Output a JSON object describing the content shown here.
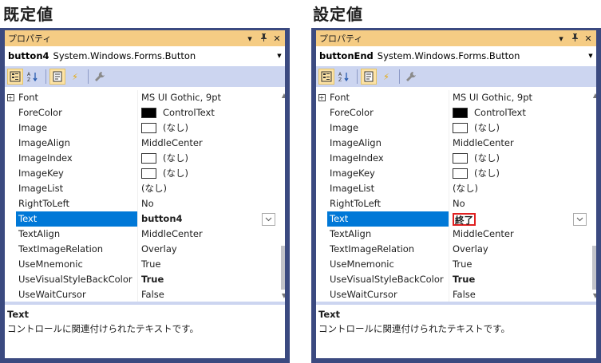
{
  "left": {
    "heading": "既定値",
    "title": "プロパティ",
    "object_name": "button4",
    "object_type": "System.Windows.Forms.Button",
    "properties": [
      {
        "name": "Font",
        "value": "MS UI Gothic, 9pt"
      },
      {
        "name": "ForeColor",
        "value": "ControlText"
      },
      {
        "name": "Image",
        "value": "(なし)"
      },
      {
        "name": "ImageAlign",
        "value": "MiddleCenter"
      },
      {
        "name": "ImageIndex",
        "value": "(なし)"
      },
      {
        "name": "ImageKey",
        "value": "(なし)"
      },
      {
        "name": "ImageList",
        "value": "(なし)"
      },
      {
        "name": "RightToLeft",
        "value": "No"
      },
      {
        "name": "Text",
        "value": "button4"
      },
      {
        "name": "TextAlign",
        "value": "MiddleCenter"
      },
      {
        "name": "TextImageRelation",
        "value": "Overlay"
      },
      {
        "name": "UseMnemonic",
        "value": "True"
      },
      {
        "name": "UseVisualStyleBackColor",
        "value": "True"
      },
      {
        "name": "UseWaitCursor",
        "value": "False"
      }
    ],
    "description_title": "Text",
    "description_text": "コントロールに関連付けられたテキストです。"
  },
  "right": {
    "heading": "設定値",
    "title": "プロパティ",
    "object_name": "buttonEnd",
    "object_type": "System.Windows.Forms.Button",
    "properties": [
      {
        "name": "Font",
        "value": "MS UI Gothic, 9pt"
      },
      {
        "name": "ForeColor",
        "value": "ControlText"
      },
      {
        "name": "Image",
        "value": "(なし)"
      },
      {
        "name": "ImageAlign",
        "value": "MiddleCenter"
      },
      {
        "name": "ImageIndex",
        "value": "(なし)"
      },
      {
        "name": "ImageKey",
        "value": "(なし)"
      },
      {
        "name": "ImageList",
        "value": "(なし)"
      },
      {
        "name": "RightToLeft",
        "value": "No"
      },
      {
        "name": "Text",
        "value": "終了"
      },
      {
        "name": "TextAlign",
        "value": "MiddleCenter"
      },
      {
        "name": "TextImageRelation",
        "value": "Overlay"
      },
      {
        "name": "UseMnemonic",
        "value": "True"
      },
      {
        "name": "UseVisualStyleBackColor",
        "value": "True"
      },
      {
        "name": "UseWaitCursor",
        "value": "False"
      }
    ],
    "description_title": "Text",
    "description_text": "コントロールに関連付けられたテキストです。"
  },
  "icons": {
    "pin": "ꟸ",
    "close": "✕",
    "dropdown": "▾",
    "expand": "+",
    "scroll_up": "▲",
    "scroll_down": "▼",
    "lightning": "⚡",
    "wrench": "🔧"
  },
  "colors": {
    "frame": "#3b4a80",
    "titlebar": "#f5cc84",
    "toolbar": "#ccd5f0",
    "selection": "#0078d7",
    "edit_highlight": "#e02020"
  }
}
